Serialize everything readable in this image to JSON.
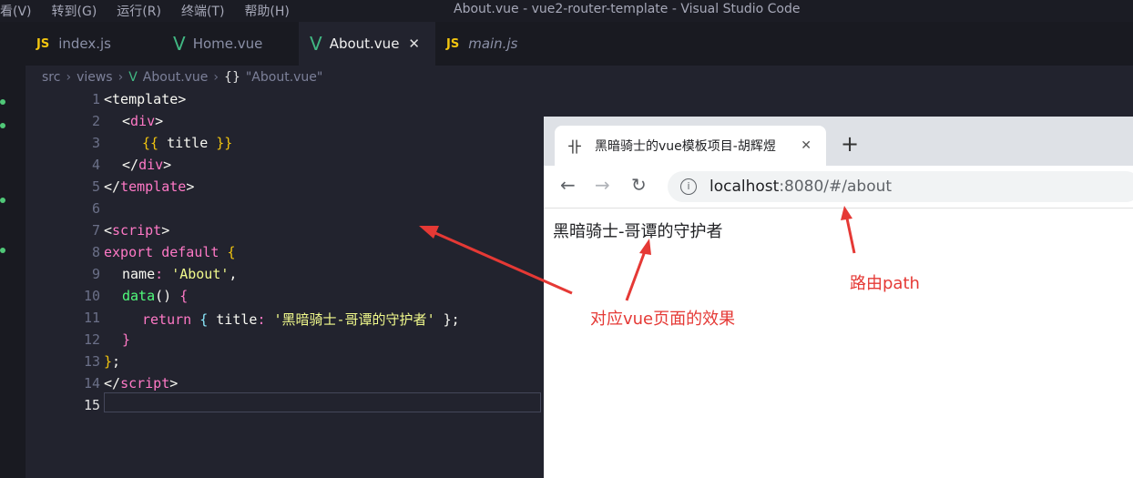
{
  "menu": {
    "items": [
      "看(V)",
      "转到(G)",
      "运行(R)",
      "终端(T)",
      "帮助(H)"
    ]
  },
  "window_title": "About.vue - vue2-router-template - Visual Studio Code",
  "tabs": [
    {
      "label": "index.js",
      "icon": "JS"
    },
    {
      "label": "Home.vue",
      "icon": "V"
    },
    {
      "label": "About.vue",
      "icon": "V",
      "close": "✕"
    },
    {
      "label": "main.js",
      "icon": "JS"
    }
  ],
  "breadcrumb": {
    "p1": "src",
    "p2": "views",
    "p3": "About.vue",
    "braces": "{}",
    "p4": "\"About.vue\""
  },
  "line_numbers": [
    "1",
    "2",
    "3",
    "4",
    "5",
    "6",
    "7",
    "8",
    "9",
    "10",
    "11",
    "12",
    "13",
    "14",
    "15"
  ],
  "code": {
    "l1": "<template>",
    "l2a": "<",
    "l2b": "div",
    "l2c": ">",
    "l3a": "{{",
    "l3b": " title ",
    "l3c": "}}",
    "l4a": "</",
    "l4b": "div",
    "l4c": ">",
    "l5a": "</",
    "l5b": "template",
    "l5c": ">",
    "l7a": "<",
    "l7b": "script",
    "l7c": ">",
    "l8a": "export default ",
    "l8b": "{",
    "l9a": "name",
    "l9b": ": ",
    "l9c": "'About'",
    "l9d": ",",
    "l10a": "data",
    "l10b": "() ",
    "l10c": "{",
    "l11a": "return ",
    "l11b": "{ ",
    "l11c": "title",
    "l11d": ": ",
    "l11e": "'黑暗骑士-哥谭的守护者'",
    "l11f": " };",
    "l12": "}",
    "l13a": "}",
    "l13b": ";",
    "l14a": "</",
    "l14b": "script",
    "l14c": ">"
  },
  "browser": {
    "tab_favicon": "卝",
    "tab_title": "黑暗骑士的vue模板项目-胡辉煜",
    "tab_close": "✕",
    "new_tab": "+",
    "back": "←",
    "forward": "→",
    "reload": "↻",
    "info_icon": "i",
    "url_host": "localhost",
    "url_path": ":8080/#/about",
    "page_text": "黑暗骑士-哥谭的守护者"
  },
  "annotations": {
    "route_path": "路由path",
    "vue_effect": "对应vue页面的效果"
  },
  "colors": {
    "accent_vue": "#41b883",
    "annotation_red": "#e53935"
  }
}
